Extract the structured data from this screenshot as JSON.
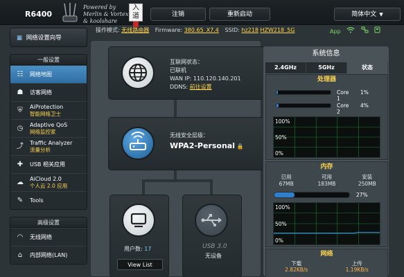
{
  "header": {
    "model": "R6400",
    "powered_by": [
      "Powered by",
      "Merlin & Vortex",
      "& koolshare"
    ],
    "seal_text": "入道",
    "logout_label": "注销",
    "reboot_label": "重新启动",
    "language_label": "简体中文"
  },
  "statusline": {
    "mode_label": "操作模式:",
    "mode_value": "无线路由器",
    "firmware_label": "Firmware:",
    "firmware_value": "380.65_X7.4",
    "ssid_label": "SSID:",
    "ssid_2g": "hz218",
    "ssid_5g": "HZW218_5G",
    "app_label": "App"
  },
  "sidebar": {
    "quick_setup": "网络设置向导",
    "general_heading": "一般设置",
    "general_items": [
      {
        "label": "网络地图",
        "sub": "",
        "icon": "network-map-icon"
      },
      {
        "label": "访客网络",
        "sub": "",
        "icon": "guest-network-icon"
      },
      {
        "label": "AiProtection",
        "sub": "智能网络卫士",
        "icon": "shield-icon"
      },
      {
        "label": "Adaptive QoS",
        "sub": "网络监控家",
        "icon": "qos-icon"
      },
      {
        "label": "Traffic Analyzer",
        "sub": "流量分析",
        "icon": "traffic-icon"
      },
      {
        "label": "USB 相关应用",
        "sub": "",
        "icon": "usb-puzzle-icon"
      },
      {
        "label": "AiCloud 2.0",
        "sub": "个人云 2.0 应用",
        "icon": "cloud-icon"
      },
      {
        "label": "Tools",
        "sub": "",
        "icon": "tools-icon"
      }
    ],
    "advanced_heading": "高级设置",
    "advanced_items": [
      {
        "label": "无线网络",
        "sub": "",
        "icon": "wifi-icon"
      },
      {
        "label": "内部网络(LAN)",
        "sub": "",
        "icon": "home-icon"
      }
    ]
  },
  "netmap": {
    "internet_status_label": "互联网状态：",
    "internet_status_value": "已联机",
    "wan_ip_label": "WAN IP:",
    "wan_ip_value": "110.120.140.201",
    "ddns_label": "DDNS:",
    "ddns_value": "前往设置",
    "security_label": "无线安全层级：",
    "security_value": "WPA2-Personal",
    "clients_label": "用户数:",
    "clients_count": "17",
    "view_list_label": "View List",
    "usb_label": "USB 3.0",
    "usb_status": "无设备"
  },
  "system": {
    "title": "系统信息",
    "tabs": [
      "2.4GHz",
      "5GHz",
      "状态"
    ],
    "active_tab": 2,
    "cpu_title": "处理器",
    "cores": [
      {
        "label": "Core 1",
        "pct": 1
      },
      {
        "label": "Core 2",
        "pct": 4
      }
    ],
    "cpu_graph_labels": [
      "100%",
      "50%",
      "0%"
    ],
    "mem_title": "内存",
    "mem_used_label": "已用",
    "mem_used": "67MB",
    "mem_free_label": "可用",
    "mem_free": "183MB",
    "mem_total_label": "安装",
    "mem_total": "250MB",
    "ram_pct": 27,
    "ram_pct_text": "27%",
    "mem_graph_labels": [
      "100%",
      "50%",
      "0%"
    ],
    "net_title": "网络",
    "net_down_label": "下载",
    "net_down": "2.82KB/s",
    "net_up_label": "上传",
    "net_up": "1.19KB/s",
    "accent": "#2f7fd0",
    "highlight": "#ffd54f"
  }
}
